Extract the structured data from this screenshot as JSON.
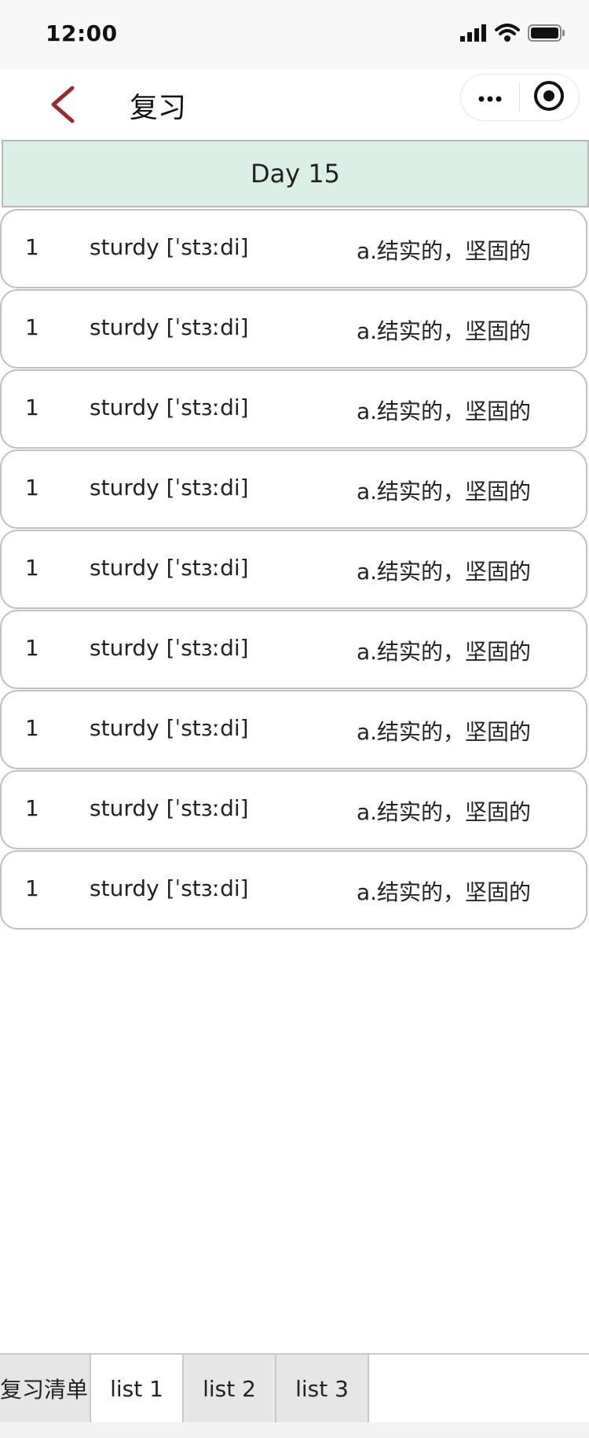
{
  "status_bar": {
    "time": "12:00",
    "icons": [
      "signal-icon",
      "wifi-icon",
      "battery-icon"
    ]
  },
  "nav": {
    "back_icon": "chevron-left-icon",
    "title": "复习",
    "more_icon": "more-dots-icon",
    "close_icon": "target-close-icon",
    "accent_color": "#9b2b2b"
  },
  "day_header": {
    "label": "Day 15",
    "background": "#daf0e6"
  },
  "words": [
    {
      "index": "1",
      "word": "sturdy [ˈstɜːdi]",
      "meaning": "a.结实的，坚固的"
    },
    {
      "index": "1",
      "word": "sturdy [ˈstɜːdi]",
      "meaning": "a.结实的，坚固的"
    },
    {
      "index": "1",
      "word": "sturdy [ˈstɜːdi]",
      "meaning": "a.结实的，坚固的"
    },
    {
      "index": "1",
      "word": "sturdy [ˈstɜːdi]",
      "meaning": "a.结实的，坚固的"
    },
    {
      "index": "1",
      "word": "sturdy [ˈstɜːdi]",
      "meaning": "a.结实的，坚固的"
    },
    {
      "index": "1",
      "word": "sturdy [ˈstɜːdi]",
      "meaning": "a.结实的，坚固的"
    },
    {
      "index": "1",
      "word": "sturdy [ˈstɜːdi]",
      "meaning": "a.结实的，坚固的"
    },
    {
      "index": "1",
      "word": "sturdy [ˈstɜːdi]",
      "meaning": "a.结实的，坚固的"
    },
    {
      "index": "1",
      "word": "sturdy [ˈstɜːdi]",
      "meaning": "a.结实的，坚固的"
    }
  ],
  "tabs": [
    {
      "label": "复习清单",
      "active": false
    },
    {
      "label": "list 1",
      "active": true
    },
    {
      "label": "list 2",
      "active": false
    },
    {
      "label": "list 3",
      "active": false
    }
  ]
}
